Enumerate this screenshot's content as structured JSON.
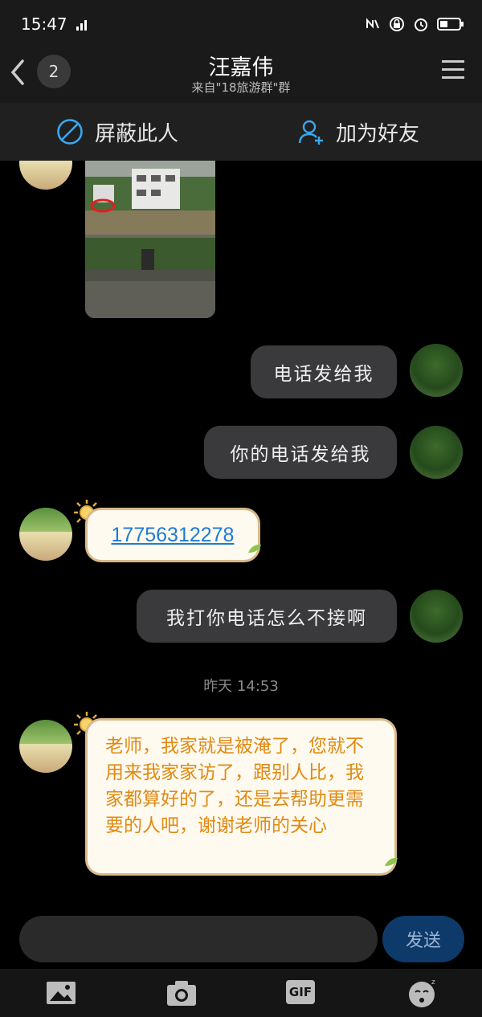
{
  "status_bar": {
    "time": "15:47",
    "network": "4G E"
  },
  "header": {
    "badge_count": "2",
    "title": "汪嘉伟",
    "subtitle": "来自\"18旅游群\"群"
  },
  "actions": {
    "block_label": "屏蔽此人",
    "add_friend_label": "加为好友"
  },
  "messages": [
    {
      "direction": "in",
      "type": "image"
    },
    {
      "direction": "out",
      "text": "电话发给我"
    },
    {
      "direction": "out",
      "text": "你的电话发给我"
    },
    {
      "direction": "in",
      "type": "phone",
      "text": "17756312278"
    },
    {
      "direction": "out",
      "text": "我打你电话怎么不接啊"
    },
    {
      "direction": "in",
      "text": "老师，我家就是被淹了，您就不用来我家家访了，跟别人比，我家都算好的了，还是去帮助更需要的人吧，谢谢老师的关心"
    }
  ],
  "timestamp": "昨天 14:53",
  "input": {
    "placeholder": "",
    "send_label": "发送"
  },
  "toolbar": {
    "gif_label": "GIF"
  },
  "colors": {
    "accent_blue": "#1f7ad6",
    "incoming_text": "#e08a12",
    "outgoing_bubble": "#3a3a3c",
    "send_button": "#0e3a6a"
  }
}
